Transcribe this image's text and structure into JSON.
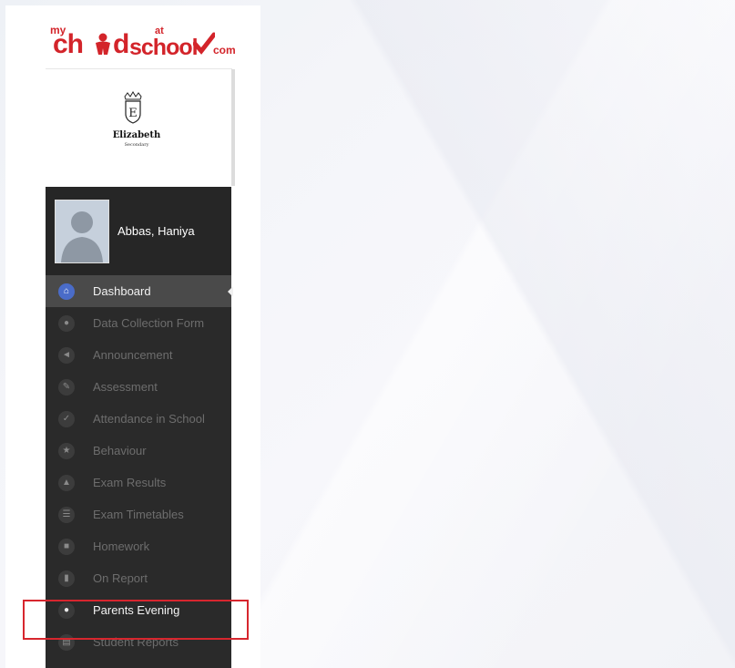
{
  "logo": {
    "my": "my",
    "ch": "ch",
    "at": "at",
    "school": "school",
    "com": "com"
  },
  "school": {
    "name": "Elizabeth",
    "sub": "Secondary",
    "crest_letter": "E"
  },
  "user": {
    "name": "Abbas, Haniya"
  },
  "nav": {
    "items": [
      {
        "label": "Dashboard",
        "icon": "home-icon",
        "state": "active"
      },
      {
        "label": "Data Collection Form",
        "icon": "user-icon",
        "state": "normal"
      },
      {
        "label": "Announcement",
        "icon": "megaphone-icon",
        "state": "normal"
      },
      {
        "label": "Assessment",
        "icon": "pencil-icon",
        "state": "normal"
      },
      {
        "label": "Attendance in School",
        "icon": "check-icon",
        "state": "normal"
      },
      {
        "label": "Behaviour",
        "icon": "star-icon",
        "state": "normal"
      },
      {
        "label": "Exam Results",
        "icon": "graduation-cap-icon",
        "state": "normal"
      },
      {
        "label": "Exam Timetables",
        "icon": "list-icon",
        "state": "normal"
      },
      {
        "label": "Homework",
        "icon": "briefcase-icon",
        "state": "normal"
      },
      {
        "label": "On Report",
        "icon": "document-icon",
        "state": "normal"
      },
      {
        "label": "Parents Evening",
        "icon": "group-icon",
        "state": "highlighted"
      },
      {
        "label": "Student Reports",
        "icon": "report-icon",
        "state": "normal"
      }
    ]
  },
  "colors": {
    "brand": "#d3242a",
    "active_icon": "#4a6cc8",
    "highlight_box": "#d7262e"
  }
}
